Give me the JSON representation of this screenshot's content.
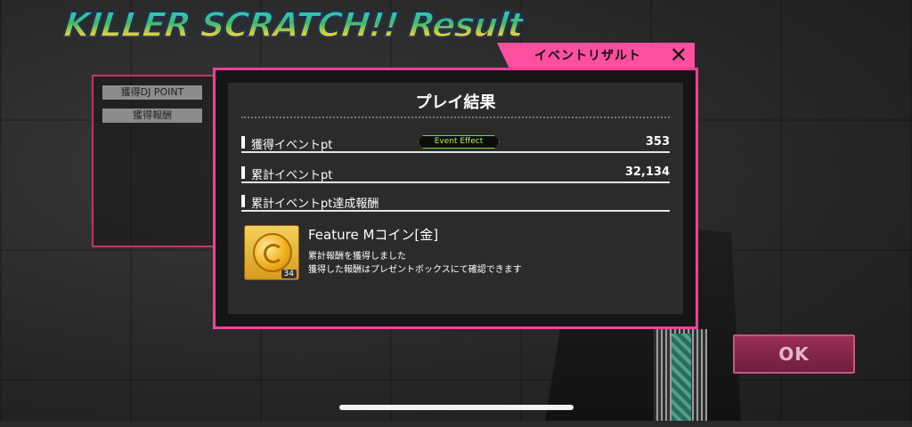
{
  "header": {
    "logo_text": "KILLER SCRATCH!! Result",
    "tab_label": "イベントリザルト",
    "close_symbol": "✕"
  },
  "background_panel": {
    "labels": [
      "獲得DJ POINT",
      "獲得報酬"
    ]
  },
  "modal": {
    "title": "プレイ結果",
    "rows": [
      {
        "label": "獲得イベントpt",
        "value": "353",
        "badge": "Event Effect"
      },
      {
        "label": "累計イベントpt",
        "value": "32,134"
      },
      {
        "label": "累計イベントpt達成報酬",
        "value": ""
      }
    ],
    "reward": {
      "name": "Feature Mコイン[金]",
      "count": "34",
      "desc_line1": "累計報酬を獲得しました",
      "desc_line2": "獲得した報酬はプレゼントボックスにて確認できます",
      "icon": "gold-coin-icon"
    }
  },
  "ok_button": {
    "label": "OK"
  },
  "colors": {
    "accent_pink": "#ff3e96",
    "ok_bg": "#8a2850",
    "effect_green": "#7fd33a"
  }
}
